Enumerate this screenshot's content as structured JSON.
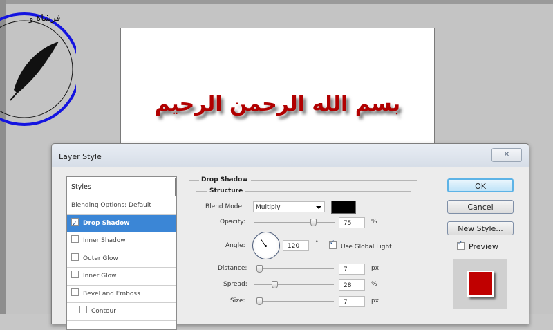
{
  "document": {
    "arabic_text": "بسم الله الرحمن الرحيم"
  },
  "dialog": {
    "title": "Layer Style",
    "close_glyph": "✕",
    "styles_header": "Styles",
    "styles": [
      {
        "label": "Blending Options: Default",
        "checkbox": false,
        "checked": false,
        "selected": false,
        "indent": false
      },
      {
        "label": "Drop Shadow",
        "checkbox": true,
        "checked": true,
        "selected": true,
        "indent": false
      },
      {
        "label": "Inner Shadow",
        "checkbox": true,
        "checked": false,
        "selected": false,
        "indent": false
      },
      {
        "label": "Outer Glow",
        "checkbox": true,
        "checked": false,
        "selected": false,
        "indent": false
      },
      {
        "label": "Inner Glow",
        "checkbox": true,
        "checked": false,
        "selected": false,
        "indent": false
      },
      {
        "label": "Bevel and Emboss",
        "checkbox": true,
        "checked": false,
        "selected": false,
        "indent": false
      },
      {
        "label": "Contour",
        "checkbox": true,
        "checked": false,
        "selected": false,
        "indent": true
      }
    ],
    "drop_shadow": {
      "section_title": "Drop Shadow",
      "structure_title": "Structure",
      "blend_mode_label": "Blend Mode:",
      "blend_mode_value": "Multiply",
      "shadow_color": "#000000",
      "opacity_label": "Opacity:",
      "opacity_value": "75",
      "opacity_unit": "%",
      "angle_label": "Angle:",
      "angle_value": "120",
      "angle_unit": "°",
      "use_global_light_label": "Use Global Light",
      "use_global_light": true,
      "distance_label": "Distance:",
      "distance_value": "7",
      "distance_unit": "px",
      "spread_label": "Spread:",
      "spread_value": "28",
      "spread_unit": "%",
      "size_label": "Size:",
      "size_value": "7",
      "size_unit": "px"
    },
    "buttons": {
      "ok": "OK",
      "cancel": "Cancel",
      "new_style": "New Style..."
    },
    "preview_label": "Preview",
    "preview_checked": true,
    "preview_color": "#c00000"
  },
  "logo": {
    "text": "فرشاة و"
  },
  "colors": {
    "accent_text": "#b10000",
    "selection": "#3b86d6"
  }
}
